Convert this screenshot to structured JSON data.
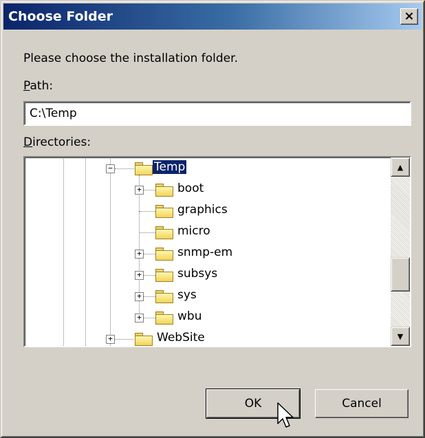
{
  "window": {
    "title": "Choose Folder",
    "close_glyph": "×"
  },
  "dialog": {
    "prompt": "Please choose the installation folder.",
    "path_label_mnemonic": "P",
    "path_label_rest": "ath:",
    "path_value": "C:\\Temp",
    "directories_label_mnemonic": "D",
    "directories_label_rest": "irectories:"
  },
  "tree": {
    "selected": "Temp",
    "nodes": [
      {
        "label": "Temp",
        "expander": "−",
        "icon": "folder-open-icon",
        "selected": true
      },
      {
        "label": "boot",
        "expander": "+",
        "icon": "folder-icon"
      },
      {
        "label": "graphics",
        "expander": "",
        "icon": "folder-icon"
      },
      {
        "label": "micro",
        "expander": "",
        "icon": "folder-icon"
      },
      {
        "label": "snmp-em",
        "expander": "+",
        "icon": "folder-icon"
      },
      {
        "label": "subsys",
        "expander": "+",
        "icon": "folder-icon"
      },
      {
        "label": "sys",
        "expander": "+",
        "icon": "folder-icon"
      },
      {
        "label": "wbu",
        "expander": "+",
        "icon": "folder-icon"
      },
      {
        "label": "WebSite",
        "expander": "+",
        "icon": "folder-icon"
      }
    ]
  },
  "scrollbar": {
    "up_glyph": "▲",
    "down_glyph": "▼"
  },
  "buttons": {
    "ok": "OK",
    "cancel": "Cancel"
  },
  "colors": {
    "title_start": "#0a246a",
    "title_end": "#a6caf0",
    "selection": "#0a246a",
    "face": "#d4d0c8"
  }
}
